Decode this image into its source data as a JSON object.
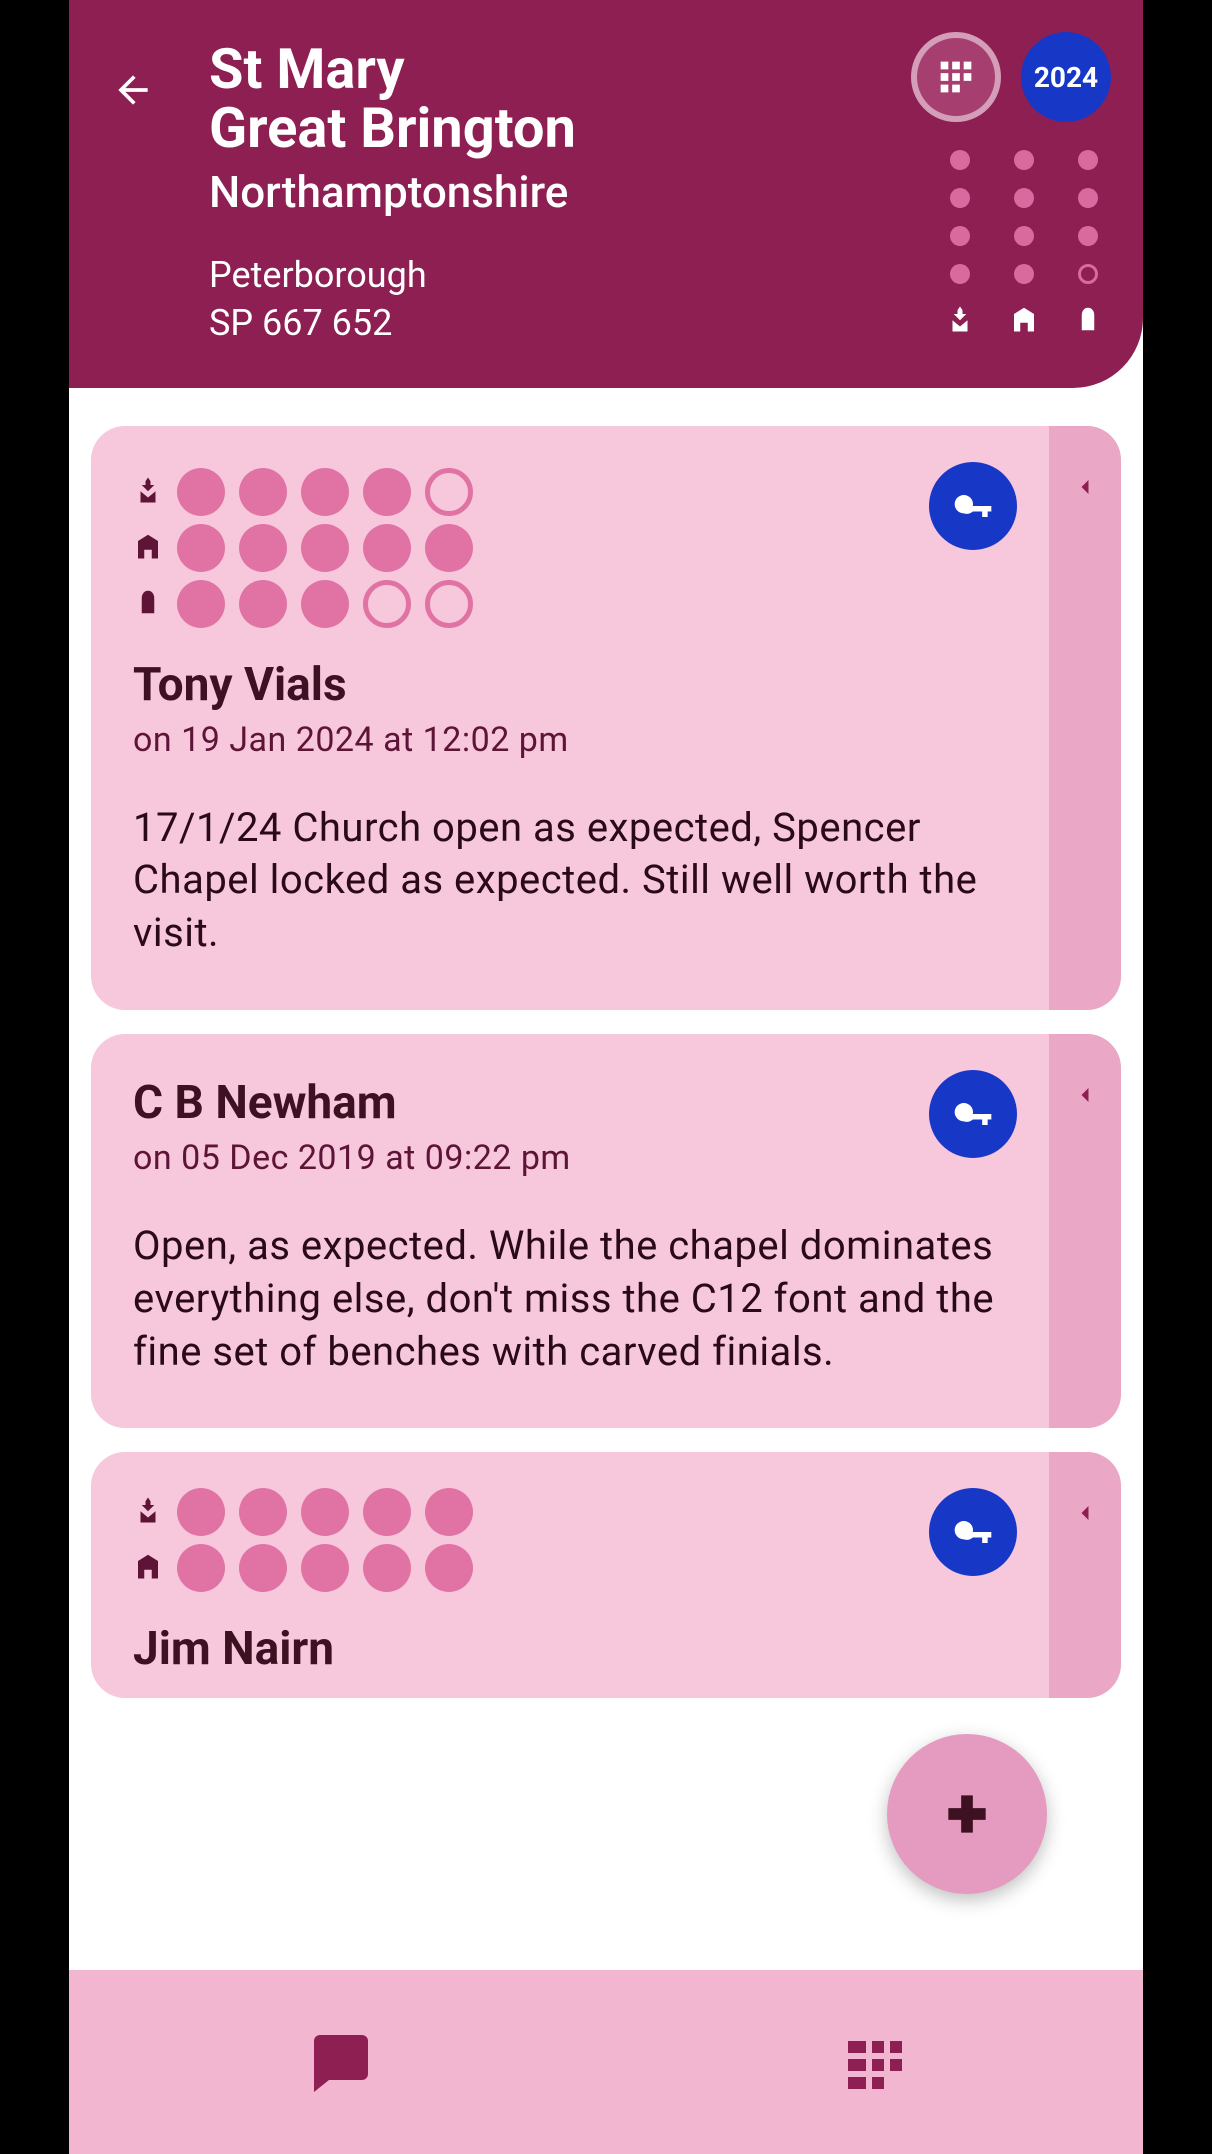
{
  "header": {
    "title_line1": "St Mary",
    "title_line2": "Great Brington",
    "county": "Northamptonshire",
    "diocese": "Peterborough",
    "gridref": "SP 667 652",
    "year_badge": "2024",
    "rating_columns": [
      {
        "icon": "church-icon",
        "filled": 4,
        "total": 4
      },
      {
        "icon": "building-icon",
        "filled": 4,
        "total": 4
      },
      {
        "icon": "window-icon",
        "filled": 3,
        "total": 4
      }
    ]
  },
  "reviews": [
    {
      "author": "Tony Vials",
      "date": "on 19 Jan 2024 at 12:02 pm",
      "text": "17/1/24 Church open as expected, Spencer Chapel locked as expected. Still well worth the visit.",
      "has_key": true,
      "ratings": [
        {
          "icon": "church-icon",
          "filled": 4,
          "total": 5
        },
        {
          "icon": "building-icon",
          "filled": 5,
          "total": 5
        },
        {
          "icon": "window-icon",
          "filled": 3,
          "total": 5
        }
      ]
    },
    {
      "author": "C B Newham",
      "date": "on 05 Dec 2019 at 09:22 pm",
      "text": "Open, as expected. While the chapel dominates everything else, don't miss the C12 font and the fine set of benches with carved finials.",
      "has_key": true,
      "ratings": []
    },
    {
      "author": "Jim Nairn",
      "date": "",
      "text": "",
      "has_key": true,
      "ratings": [
        {
          "icon": "church-icon",
          "filled": 5,
          "total": 5
        },
        {
          "icon": "building-icon",
          "filled": 5,
          "total": 5
        }
      ]
    }
  ]
}
